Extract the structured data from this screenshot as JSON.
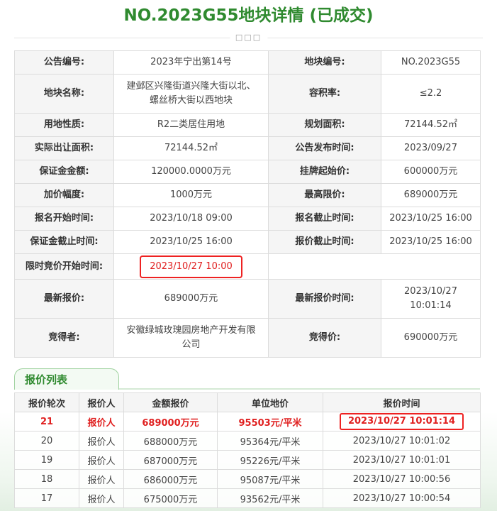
{
  "page": {
    "title": "NO.2023G55地块详情 (已成交)",
    "divider_dots": "□□□"
  },
  "detail": {
    "announcement_no_label": "公告编号:",
    "announcement_no": "2023年宁出第14号",
    "parcel_no_label": "地块编号:",
    "parcel_no": "NO.2023G55",
    "parcel_name_label": "地块名称:",
    "parcel_name_line1": "建邺区兴隆街道兴隆大街以北、",
    "parcel_name_line2": "螺丝桥大街以西地块",
    "plot_ratio_label": "容积率:",
    "plot_ratio": "≤2.2",
    "land_use_label": "用地性质:",
    "land_use": "R2二类居住用地",
    "planned_area_label": "规划面积:",
    "planned_area": "72144.52㎡",
    "actual_area_label": "实际出让面积:",
    "actual_area": "72144.52㎡",
    "publish_time_label": "公告发布时间:",
    "publish_time": "2023/09/27",
    "deposit_label": "保证金金额:",
    "deposit": "120000.0000万元",
    "start_price_label": "挂牌起始价:",
    "start_price": "600000万元",
    "increment_label": "加价幅度:",
    "increment": "1000万元",
    "max_price_label": "最高限价:",
    "max_price": "689000万元",
    "reg_start_label": "报名开始时间:",
    "reg_start": "2023/10/18 09:00",
    "reg_end_label": "报名截止时间:",
    "reg_end": "2023/10/25 16:00",
    "deposit_end_label": "保证金截止时间:",
    "deposit_end": "2023/10/25 16:00",
    "quote_end_label": "报价截止时间:",
    "quote_end": "2023/10/25 16:00",
    "timed_bid_start_label": "限时竞价开始时间:",
    "timed_bid_start": "2023/10/27 10:00",
    "latest_quote_label": "最新报价:",
    "latest_quote": "689000万元",
    "latest_quote_time_label": "最新报价时间:",
    "latest_quote_date": "2023/10/27",
    "latest_quote_clock": "10:01:14",
    "winner_label": "竞得者:",
    "winner_line1": "安徽绿城玫瑰园房地产开发有限",
    "winner_line2": "公司",
    "winning_price_label": "竞得价:",
    "winning_price": "690000万元"
  },
  "bids": {
    "tab_label": "报价列表",
    "headers": [
      "报价轮次",
      "报价人",
      "金额报价",
      "单位地价",
      "报价时间"
    ],
    "rows": [
      {
        "round": "21",
        "bidder": "报价人",
        "amount": "689000万元",
        "unit_price": "95503元/平米",
        "time": "2023/10/27 10:01:14"
      },
      {
        "round": "20",
        "bidder": "报价人",
        "amount": "688000万元",
        "unit_price": "95364元/平米",
        "time": "2023/10/27 10:01:02"
      },
      {
        "round": "19",
        "bidder": "报价人",
        "amount": "687000万元",
        "unit_price": "95226元/平米",
        "time": "2023/10/27 10:01:01"
      },
      {
        "round": "18",
        "bidder": "报价人",
        "amount": "686000万元",
        "unit_price": "95087元/平米",
        "time": "2023/10/27 10:00:56"
      },
      {
        "round": "17",
        "bidder": "报价人",
        "amount": "675000万元",
        "unit_price": "93562元/平米",
        "time": "2023/10/27 10:00:54"
      }
    ]
  }
}
